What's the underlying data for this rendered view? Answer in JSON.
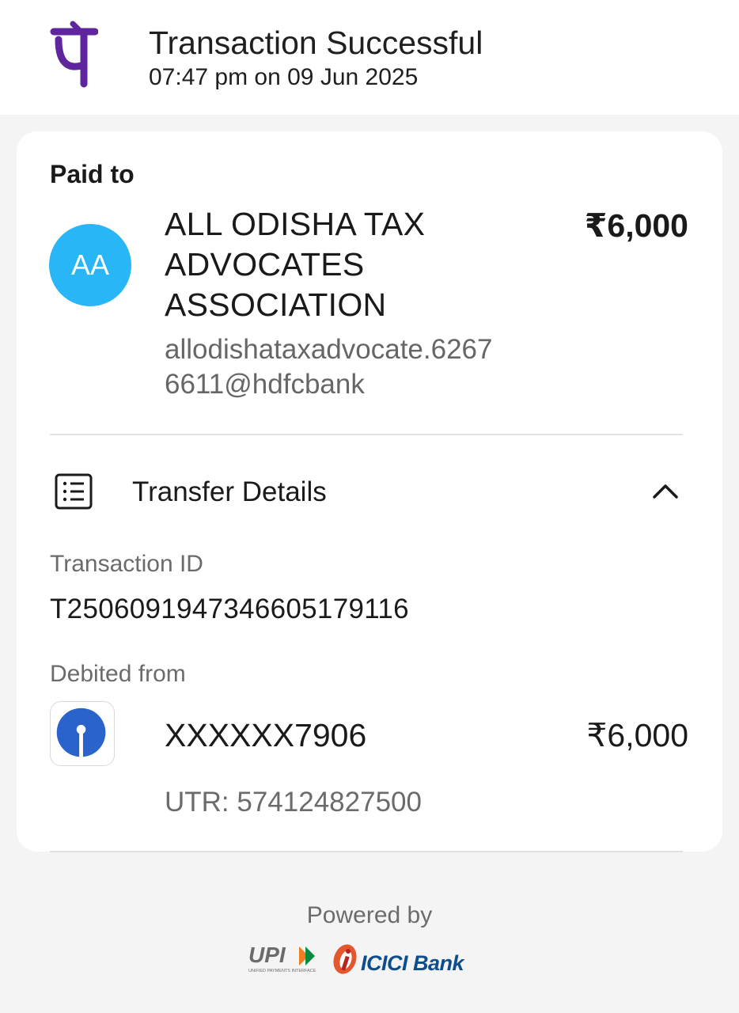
{
  "header": {
    "logo_icon": "phonepe-logo",
    "title": "Transaction Successful",
    "timestamp": "07:47 pm on 09 Jun 2025",
    "brand_color": "#5f259f"
  },
  "paid_to": {
    "label": "Paid to",
    "avatar_initials": "AA",
    "avatar_color": "#29b6f6",
    "payee_name": "ALL ODISHA TAX ADVOCATES ASSOCIATION",
    "payee_vpa": "allodishataxadvocate.62676611@hdfcbank",
    "amount": "₹6,000"
  },
  "transfer_details": {
    "icon": "receipt-list-icon",
    "label": "Transfer Details",
    "toggle_icon": "chevron-up-icon",
    "transaction_id_label": "Transaction ID",
    "transaction_id": "T2506091947346605179116",
    "debited_from_label": "Debited from",
    "bank_icon": "sbi-logo",
    "bank_color": "#2a63cc",
    "account": "XXXXXX7906",
    "debited_amount": "₹6,000",
    "utr": "UTR: 574124827500"
  },
  "footer": {
    "powered_by": "Powered by",
    "upi_logo_text": "UPI",
    "upi_tagline": "UNIFIED PAYMENTS INTERFACE",
    "partner_bank": "ICICI Bank",
    "partner_color": "#0d4d8c"
  }
}
